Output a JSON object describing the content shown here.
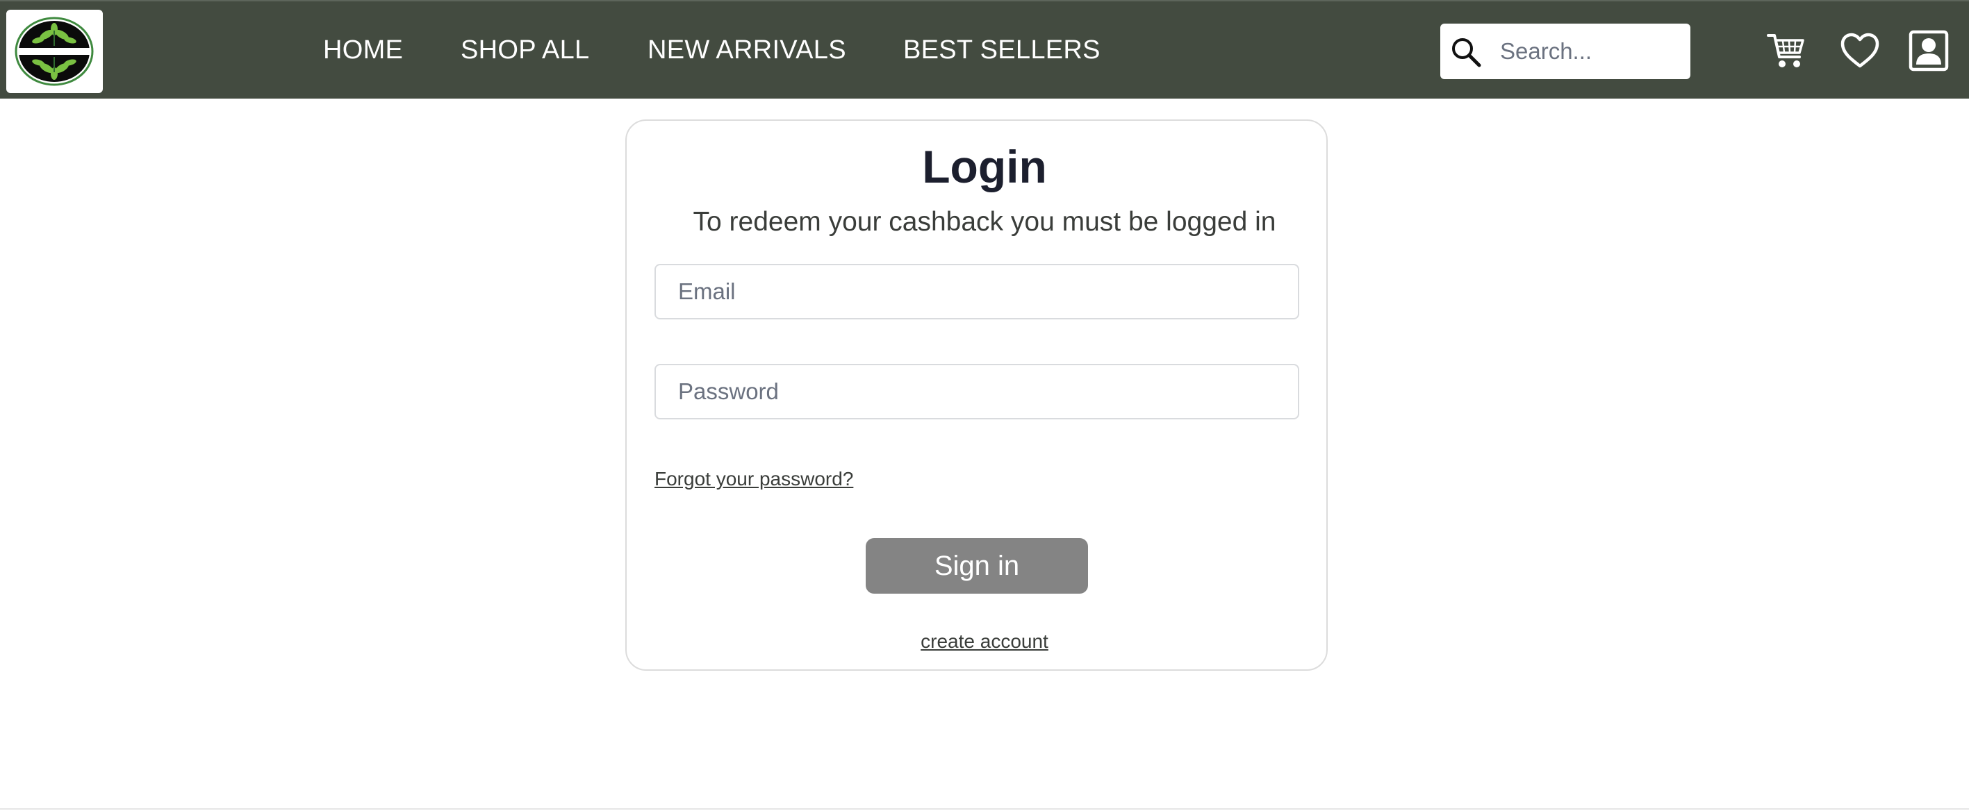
{
  "nav": {
    "links": [
      "HOME",
      "SHOP ALL",
      "NEW ARRIVALS",
      "BEST SELLERS"
    ],
    "search_placeholder": "Search...",
    "icons": [
      "logo",
      "search-icon",
      "cart-icon",
      "heart-icon",
      "account-icon"
    ],
    "background_color": "#434b40"
  },
  "login": {
    "title": "Login",
    "subtitle": "To redeem your cashback you must be logged in",
    "email_placeholder": "Email",
    "password_placeholder": "Password",
    "forgot_label": "Forgot your password?",
    "signin_label": "Sign in",
    "create_label": "create account",
    "button_color": "#848484"
  }
}
